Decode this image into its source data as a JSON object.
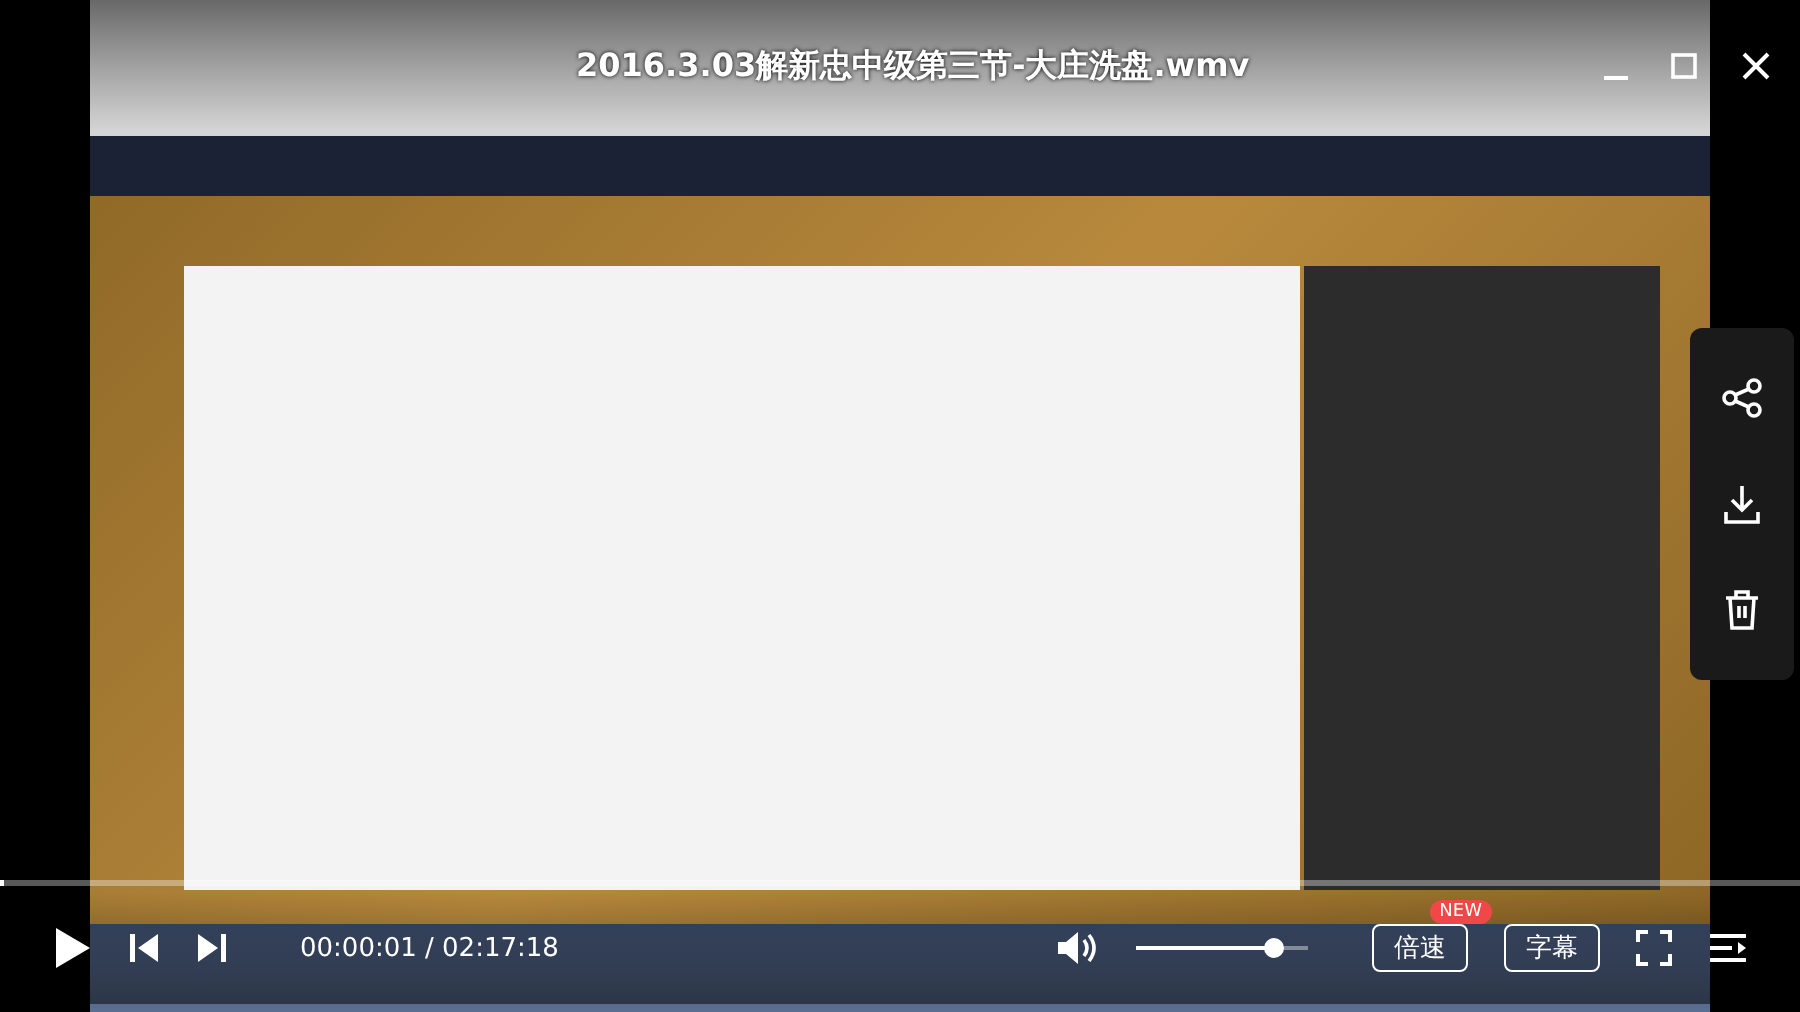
{
  "title": "2016.3.03解新忠中级第三节-大庄洗盘.wmv",
  "progress": {
    "level": 0.002
  },
  "time": "00:00:01 / 02:17:18",
  "volume": {
    "level": 0.8
  },
  "buttons": [
    {
      "label": "倍速",
      "badge": "NEW"
    },
    {
      "label": "字幕"
    }
  ]
}
